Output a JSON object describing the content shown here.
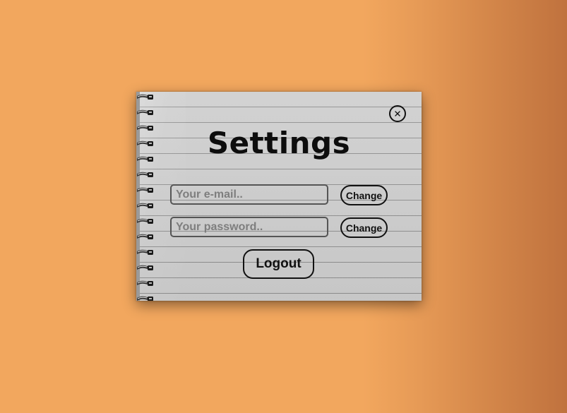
{
  "modal": {
    "title": "Settings",
    "close_icon": "close-x-icon",
    "spiral_icon": "spiral-binding-icon",
    "email": {
      "placeholder": "Your e-mail..",
      "value": "",
      "button_label": "Change"
    },
    "password": {
      "placeholder": "Your password..",
      "value": "",
      "button_label": "Change"
    },
    "logout_label": "Logout"
  },
  "colors": {
    "background_orange": "#f2a75e",
    "background_edge": "#c0723e",
    "paper": "#cdcdcd",
    "rule_line": "#8e8e8e",
    "ink": "#111111",
    "placeholder": "#7e7e7e"
  }
}
